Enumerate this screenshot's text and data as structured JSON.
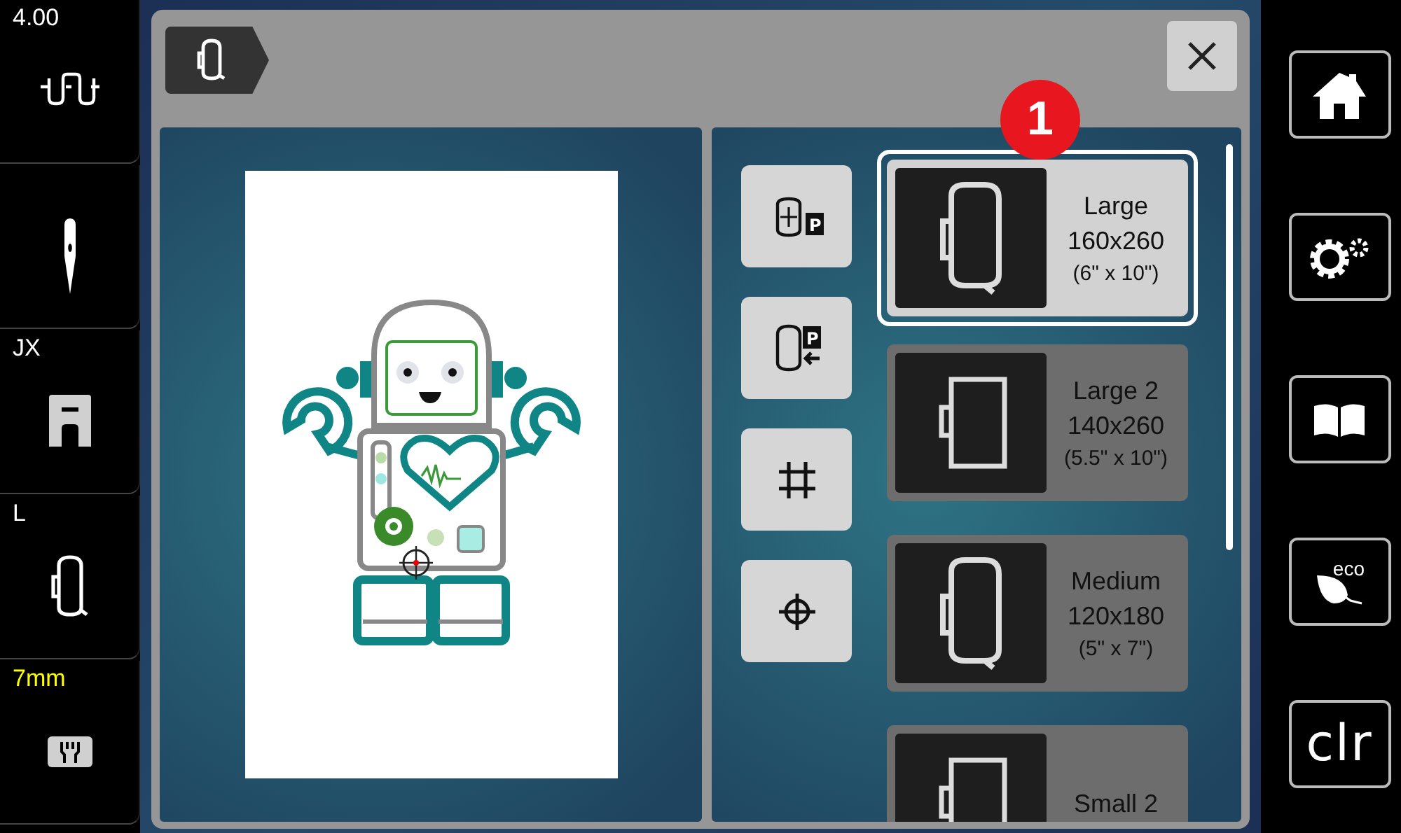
{
  "status_sidebar": [
    {
      "kind": "tension",
      "label": "4.00",
      "color": "#ffffff"
    },
    {
      "kind": "needle"
    },
    {
      "kind": "foot",
      "label": "JX",
      "color": "#ffffff"
    },
    {
      "kind": "hoop",
      "label": "L",
      "color": "#ffffff"
    },
    {
      "kind": "plate",
      "label": "7mm",
      "color": "#ffff00"
    }
  ],
  "badge": "1",
  "tools": [
    {
      "kind": "center-park",
      "mark": "P"
    },
    {
      "kind": "park",
      "mark": "P"
    },
    {
      "kind": "grid"
    },
    {
      "kind": "center"
    }
  ],
  "hoops": [
    {
      "kind": "oval",
      "name": "Large",
      "size": "160x260",
      "inches": "(6\" x 10\")",
      "selected": true
    },
    {
      "kind": "rect",
      "name": "Large 2",
      "size": "140x260",
      "inches": "(5.5\" x 10\")",
      "selected": false
    },
    {
      "kind": "oval",
      "name": "Medium",
      "size": "120x180",
      "inches": "(5\" x 7\")",
      "selected": false
    },
    {
      "kind": "rect",
      "name": "Small 2",
      "selected": false
    }
  ],
  "nav": [
    {
      "kind": "home"
    },
    {
      "kind": "settings"
    },
    {
      "kind": "manual"
    },
    {
      "kind": "eco",
      "label": "eco"
    },
    {
      "kind": "clear",
      "label": "clr"
    }
  ]
}
